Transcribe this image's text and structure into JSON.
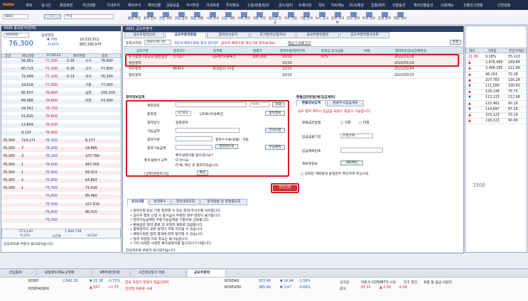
{
  "app": {
    "logo": "Hable",
    "menu": [
      "계좌",
      "실시간",
      "종합화면",
      "자산현황",
      "국내주식",
      "해외주식",
      "해외선물",
      "금융상품",
      "주식주문",
      "국내파생",
      "투자정보",
      "신용/대출/담보",
      "골드/달러",
      "트레이딩",
      "챠트",
      "차트메뉴",
      "ELS/채권",
      "업종/테마",
      "선물옵션",
      "해외선물옵션",
      "사용메뉴",
      "선물잔고현황"
    ],
    "right": "간편설정"
  },
  "toolbar": {
    "items": [
      "통합 주문",
      "종목 정보",
      "관련 차트",
      "관심 종목",
      "업종 현황",
      "시세 분석",
      "신용 거래",
      "이체 관리",
      "자동 주문",
      "실시간 잔고",
      "지수 연동",
      "기업 분석",
      "뉴스 공시",
      "증권 사이트",
      "잔고 정리",
      "투자 정보",
      "증권 종목",
      "회원 정보"
    ]
  },
  "left_panel": {
    "title": "4989 종목분석(현재)",
    "code": "005930",
    "stock": "삼성전자",
    "price": "76,300",
    "change": "▼ 700",
    "rate": "-0.91%",
    "vol1": "10,533,913",
    "vol2": "805,396,970",
    "tick_head": [
      "증감",
      "매도잔량",
      "15:26:41",
      "매수잔량",
      "증감"
    ],
    "rows": [
      [
        "",
        "56,991",
        "77,300",
        "0.39",
        "시가",
        "76,800"
      ],
      [
        "",
        "60,729",
        "77,200",
        "0.26",
        "고가",
        "77,800"
      ],
      [
        "",
        "72,049",
        "77,100",
        "0.13",
        "저가",
        "76,300"
      ],
      [
        "",
        "19,618",
        "77,000",
        "",
        "기준",
        "77,000"
      ],
      [
        "",
        "85,507",
        "76,900",
        "",
        "상한",
        "100,100"
      ],
      [
        "",
        "84,988",
        "76,800",
        "",
        "하한",
        "53,900"
      ],
      [
        "",
        "29,542",
        "76,700",
        "",
        "",
        ""
      ],
      [
        "",
        "51,815",
        "76,600",
        "",
        "",
        ""
      ],
      [
        "",
        "13,849",
        "76,500",
        "",
        "",
        ""
      ],
      [
        "",
        "9,124",
        "76,400",
        "",
        "",
        ""
      ],
      [
        "76,300",
        "724,171",
        "76,300",
        "",
        "6,177",
        ""
      ],
      [
        "76,300",
        "7",
        "76,200",
        "",
        "24,685",
        ""
      ],
      [
        "76,300",
        "3",
        "76,100",
        "",
        "107,789",
        ""
      ],
      [
        "76,300",
        "1",
        "76,000",
        "",
        "447,365",
        ""
      ],
      [
        "76,300",
        "1",
        "75,900",
        "",
        "69,913",
        ""
      ],
      [
        "76,300",
        "2",
        "75,800",
        "",
        "64,893",
        ""
      ],
      [
        "76,300",
        "1",
        "75,700",
        "",
        "71,416",
        ""
      ],
      [
        "",
        "",
        "75,600",
        "",
        "85,460",
        ""
      ],
      [
        "",
        "",
        "75,500",
        "",
        "227,919",
        ""
      ],
      [
        "",
        "",
        "75,400",
        "",
        "86,415",
        ""
      ],
      [
        "",
        "",
        "75,300",
        "",
        "",
        ""
      ]
    ],
    "summary": [
      "573,140",
      "1,868,798",
      "-5,573",
      "시간외",
      "9,134"
    ],
    "note": "잔상외으로 주문가 표시되어습니다."
  },
  "main": {
    "title": "0881 공모주청약",
    "tabs1": [
      "공모주청약안내",
      "공모주청약종합",
      "청약안내공지",
      "초가청약신청/취소",
      "공모주청약결과",
      "공모주청약결과조회"
    ],
    "account_label": "조회시작일",
    "start_date": "2022-01-10",
    "notice": "3년내 배정수량을 알고 싶다면!",
    "notice_red": "공모주 배정수량 계산기로 알아보세요!",
    "notice2": "계산기 바로가기",
    "query": "조회",
    "grid_head": [
      "공모구분",
      "종목코드",
      "종목명",
      "발행가",
      "청약수량/청약단위",
      "청약금 증거금률",
      "비례",
      "청약마감일/상장예정일"
    ],
    "grid_rows": [
      [
        "유가증권시장공모/일반청약",
        "37322",
        "LG에너지솔루션",
        "300,000",
        "10/10",
        "50%",
        "",
        "2022/01/18"
      ],
      [
        "일반청약",
        "",
        "",
        "",
        "10/10",
        "",
        "",
        "2022/01/19"
      ],
      [
        "우리청약",
        "86454",
        "현대엔지니어링",
        "",
        "10/10",
        "",
        "",
        "2022/02/04"
      ],
      [
        "일반청약",
        "",
        "",
        "",
        "10/10",
        "",
        "",
        "2022/02/15"
      ]
    ],
    "form": {
      "title": "청약정보입력",
      "acc": "계좌번호",
      "acc_val": "",
      "pw": "••••",
      "pw_btn": "조회",
      "code_lbl": "종목명",
      "code": "37322",
      "code_name": "LG에너지솔루션",
      "code_btn": "종목정보",
      "price_lbl": "청약방식",
      "price_val": "일괄청약",
      "qty_lbl": "가능금액",
      "qty_btn": "유의사항",
      "amt_lbl": "청약수량",
      "amt_hint": "청약수수료(원불) : 0원",
      "amt_btn": "청약한도표",
      "lim_lbl": "청약가능금액",
      "lim_btn": "수요예측",
      "inv_lbl": "투자설명서 교부",
      "inv_q": "투자설명서를 읽으셨나요?",
      "inv_y": "O 아니요",
      "inv_n": "O 예, 확인 후 청약하겠습니다.",
      "sel_lbl": "(선택)관련자사인",
      "sel_btn": "확인"
    },
    "submit": "청약신청",
    "right_form": {
      "title": "환불금전방법(예/입금계좌)",
      "tabs": [
        "환불정보입력",
        "환불주식입금계좌"
      ],
      "line1": "환불금전방법",
      "line2": "입금금융기관",
      "line3": "입금계좌번호",
      "line4": "계좌명정보",
      "opt1": "○ 자행",
      "opt2": "○ 타행",
      "red": "공모 청약 해지시 입금금 교환시 출금이 가능합니다.",
      "btn": "은행선택",
      "btn2": "계좌확인",
      "note": "○ 조회된 계좌명과 동일한지 확인하여 주십시오."
    },
    "info_tabs": [
      "유의사항",
      "청약매수",
      "청약내역조회",
      "청약방법 및 경쟁률조회"
    ],
    "info_lines": [
      "• 청약수량 또는 기준 청약할 수 있는 최대 주식수를 의미합니다.",
      "• 공모주 청약 신청 시 증거금이 부족할 경우 청약이 불가합니다.",
      "• 청약가능금액은 주문가능금액을 기준으로 산출됩니다.",
      "• 환불금은 청약 종료 후 지정된 계좌로 입금됩니다.",
      "• 중복청약시 모든 청약이 무효 처리될 수 있습니다.",
      "• 배정수량은 청약 결과에 따라 달라질 수 있습니다.",
      "• 청약 마감일 이후 취소는 불가능합니다.",
      "• 기타 자세한 사항은 투자설명서를 참고하시기 바랍니다."
    ],
    "status": "잔상외으로 주문가 표시되어습니다."
  },
  "right_panel": {
    "cols": [
      "대비",
      "거래량",
      "전일거래량"
    ],
    "rows": [
      [
        "21.36",
        "0.18%",
        "55,123"
      ],
      [
        "▲",
        "2,676,989",
        "169.84"
      ],
      [
        "▲",
        "3,498,185",
        "111.99"
      ],
      [
        "▲",
        "46,154",
        "70.18"
      ],
      [
        "▲",
        "107,783",
        "135.28"
      ],
      [
        "▼",
        "111,580",
        "190.63"
      ],
      [
        "▲",
        "126,148",
        "75.75"
      ],
      [
        "▼",
        "113,123",
        "112.98"
      ],
      [
        "▲",
        "125,461",
        "90.19"
      ],
      [
        "▼",
        "114,897",
        "87.28"
      ],
      [
        "▲",
        "103,123",
        "33.29"
      ],
      [
        "▲",
        "116,321",
        "90.99"
      ]
    ],
    "big": "1500"
  },
  "bottom_tabs": [
    "관심종목",
    "당일매수/매도상위매",
    "KB주문(현재)",
    "시간외단일가 주문",
    "공모주청약"
  ],
  "ticker": {
    "row1": [
      "KOSPI",
      "▼",
      "2,842.28",
      "▼ 21.36",
      "-0.75%",
      "한국 지정가 현재가 현금(100)",
      "KOSDAQ",
      "933.96",
      "▼ 16.94",
      "-1.56%",
      "선거관",
      "자본서 2만5887가 나오",
      "하구 권건",
      "포함 등 공급 의원리"
    ],
    "row2": [
      "KOSDAQ종목",
      "▲",
      "1",
      "▲ 557",
      "+7.73",
      "전성된 자료로 시세",
      "KOSPI200",
      "385.89",
      "▼ 3.47",
      "-0.89%",
      "광고",
      "97.31",
      "▲ 1.00",
      "-1.56"
    ]
  }
}
